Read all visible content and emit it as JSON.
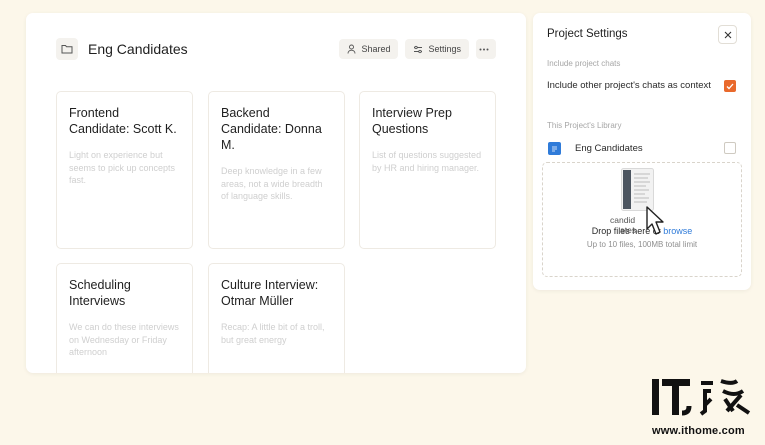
{
  "project": {
    "title": "Eng Candidates",
    "shared_label": "Shared",
    "settings_label": "Settings"
  },
  "cards": [
    {
      "title": "Frontend Candidate: Scott K.",
      "description": "Light on experience but seems to pick up concepts fast."
    },
    {
      "title": "Backend Candidate: Donna M.",
      "description": "Deep knowledge in a few areas, not a wide breadth of language skills."
    },
    {
      "title": "Interview Prep Questions",
      "description": "List of questions suggested by HR and hiring manager."
    },
    {
      "title": "Scheduling Interviews",
      "description": "We can do these interviews on Wednesday or Friday afternoon"
    },
    {
      "title": "Culture Interview: Otmar Müller",
      "description": "Recap: A little bit of a troll, but great energy"
    }
  ],
  "settings_panel": {
    "title": "Project Settings",
    "chats_section_label": "Include project chats",
    "include_chats_label": "Include other project's chats as context",
    "include_chats_checked": true,
    "library_section_label": "This Project's Library",
    "library_item_label": "Eng Candidates",
    "library_item_checked": false,
    "drop_text_prefix": "Drop files here or ",
    "drop_browse_label": "browse",
    "drop_limit_text": "Up to 10 files, 100MB total limit"
  },
  "dragged_file": {
    "name_line1": "candid",
    "name_line2": "ates"
  },
  "watermark": {
    "url": "www.ithome.com"
  },
  "colors": {
    "background": "#fcf7ea",
    "accent_orange": "#e9692c",
    "link_blue": "#2f7bd9"
  }
}
